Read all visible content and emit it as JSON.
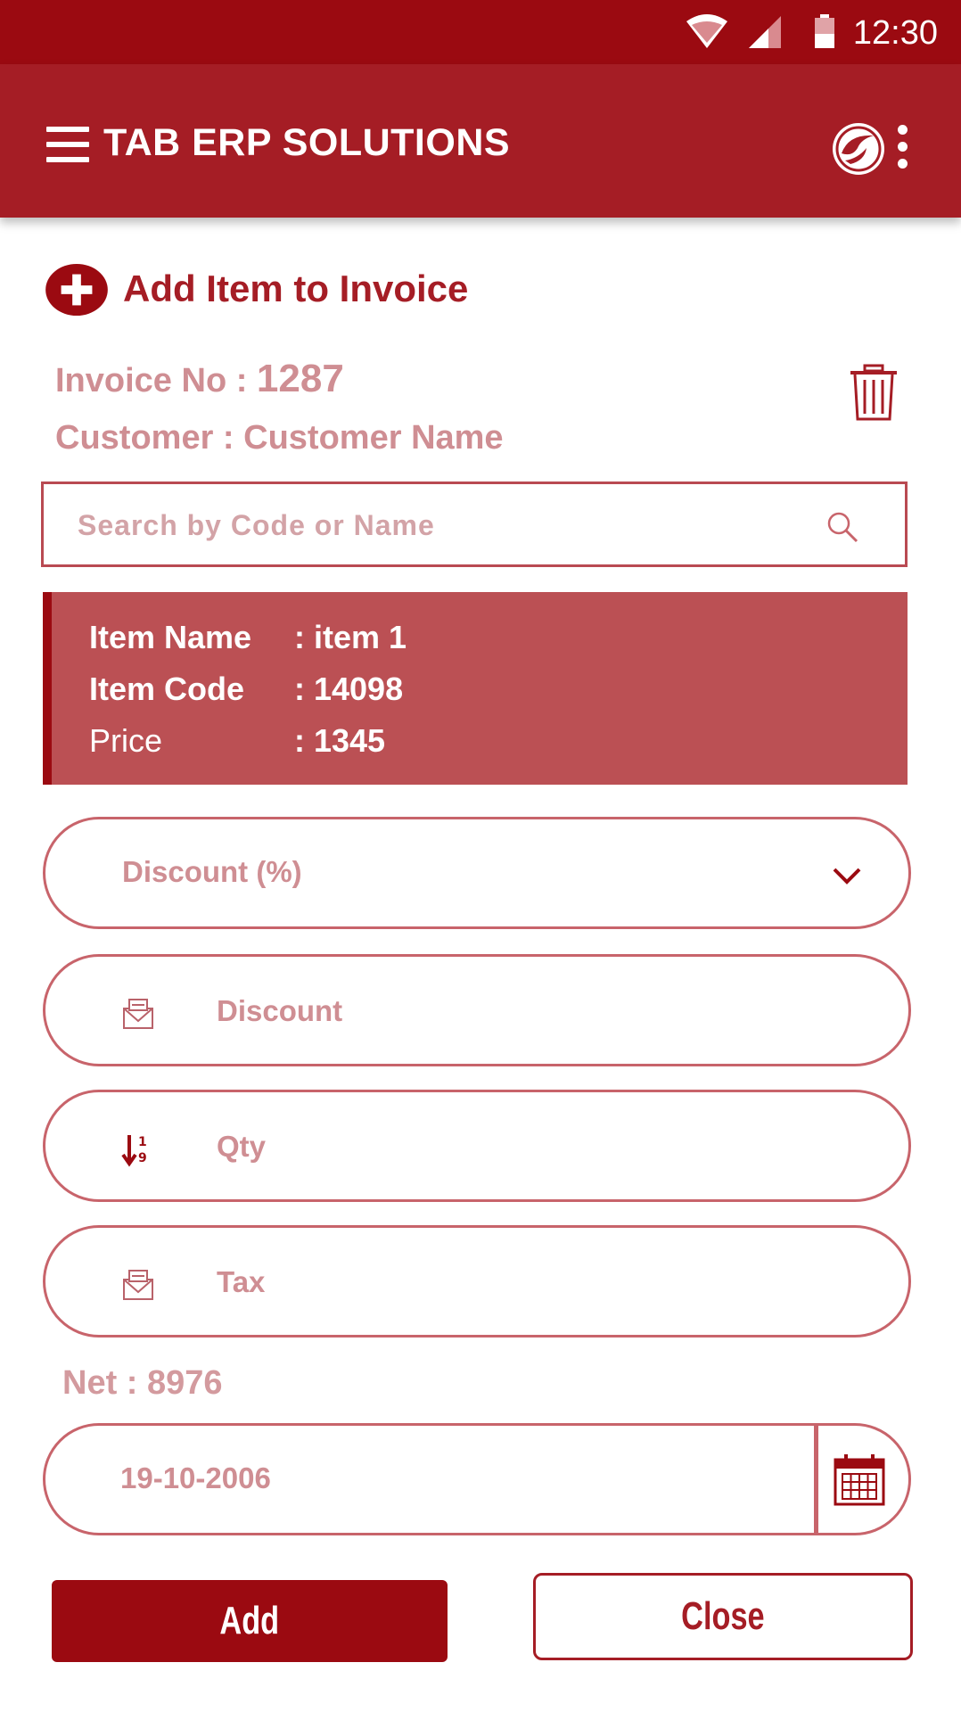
{
  "status_bar": {
    "time": "12:30",
    "icons": [
      "wifi-icon",
      "cell-signal-icon",
      "battery-icon"
    ]
  },
  "app_bar": {
    "title": "TAB ERP SOLUTIONS",
    "icons": [
      "menu-icon",
      "app-logo-icon",
      "overflow-menu-icon"
    ]
  },
  "section": {
    "title": "Add Item to Invoice"
  },
  "invoice": {
    "label": "Invoice No : ",
    "number": "1287",
    "customer_label": "Customer : ",
    "customer_name": "Customer Name"
  },
  "search": {
    "placeholder": "Search by Code or Name",
    "value": ""
  },
  "item": {
    "name_label": "Item Name",
    "name": ": item 1",
    "code_label": "Item Code",
    "code": ": 14098",
    "price_label": "Price",
    "price": ": 1345"
  },
  "form": {
    "discount_type": "Discount (%)",
    "discount_placeholder": "Discount",
    "qty_placeholder": "Qty",
    "tax_placeholder": "Tax",
    "net": "Net : 8976",
    "date": "19-10-2006"
  },
  "buttons": {
    "add": "Add",
    "close": "Close"
  },
  "colors": {
    "primary": "#9b0a11",
    "appbar": "#a51d25",
    "card": "#bb5054",
    "muted_text": "#cf8e93"
  }
}
